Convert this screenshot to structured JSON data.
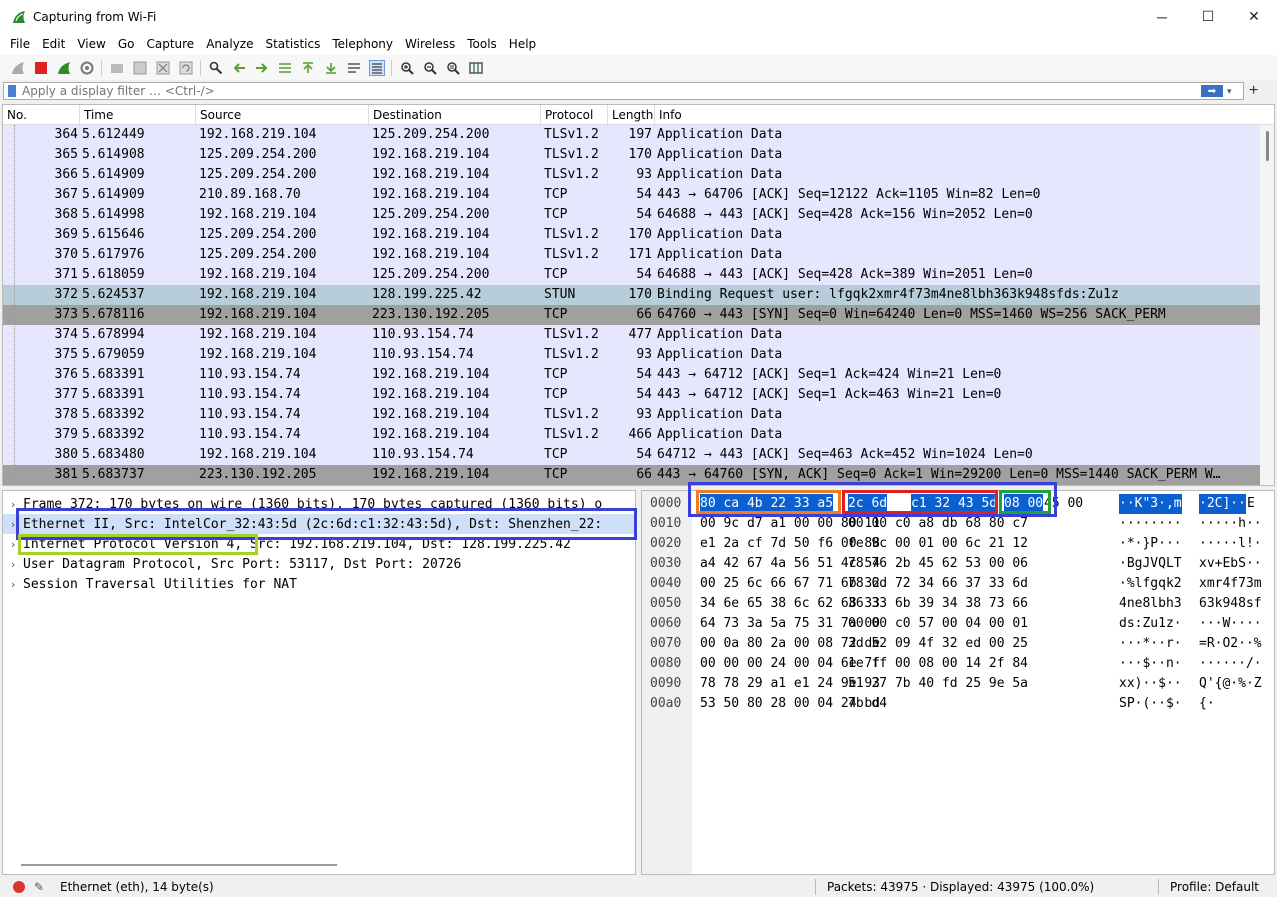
{
  "window": {
    "title": "Capturing from Wi-Fi",
    "minimize": "─",
    "maximize": "☐",
    "close": "✕"
  },
  "menu": [
    "File",
    "Edit",
    "View",
    "Go",
    "Capture",
    "Analyze",
    "Statistics",
    "Telephony",
    "Wireless",
    "Tools",
    "Help"
  ],
  "toolbar": {
    "icons": [
      "shark-fin-icon",
      "stop-capture-icon",
      "restart-capture-icon",
      "capture-options-icon",
      "open-file-icon",
      "save-file-icon",
      "close-file-icon",
      "reload-file-icon",
      "find-packet-icon",
      "go-back-icon",
      "go-forward-icon",
      "go-to-packet-icon",
      "go-first-icon",
      "go-last-icon",
      "auto-scroll-icon",
      "colorize-icon",
      "zoom-in-icon",
      "zoom-out-icon",
      "zoom-normal-icon",
      "resize-columns-icon"
    ]
  },
  "filter": {
    "placeholder": "Apply a display filter … <Ctrl-/>",
    "apply_label": "➡",
    "dropdown": "▾",
    "plus": "+"
  },
  "packet_list": {
    "columns": [
      "No.",
      "Time",
      "Source",
      "Destination",
      "Protocol",
      "Length",
      "Info"
    ],
    "rows": [
      {
        "no": "364",
        "time": "5.612449",
        "src": "192.168.219.104",
        "dst": "125.209.254.200",
        "proto": "TLSv1.2",
        "len": "197",
        "info": "Application Data",
        "style": "tls"
      },
      {
        "no": "365",
        "time": "5.614908",
        "src": "125.209.254.200",
        "dst": "192.168.219.104",
        "proto": "TLSv1.2",
        "len": "170",
        "info": "Application Data",
        "style": "tls"
      },
      {
        "no": "366",
        "time": "5.614909",
        "src": "125.209.254.200",
        "dst": "192.168.219.104",
        "proto": "TLSv1.2",
        "len": "93",
        "info": "Application Data",
        "style": "tls"
      },
      {
        "no": "367",
        "time": "5.614909",
        "src": "210.89.168.70",
        "dst": "192.168.219.104",
        "proto": "TCP",
        "len": "54",
        "info": "443 → 64706 [ACK] Seq=12122 Ack=1105 Win=82 Len=0",
        "style": "tcp"
      },
      {
        "no": "368",
        "time": "5.614998",
        "src": "192.168.219.104",
        "dst": "125.209.254.200",
        "proto": "TCP",
        "len": "54",
        "info": "64688 → 443 [ACK] Seq=428 Ack=156 Win=2052 Len=0",
        "style": "tcp"
      },
      {
        "no": "369",
        "time": "5.615646",
        "src": "125.209.254.200",
        "dst": "192.168.219.104",
        "proto": "TLSv1.2",
        "len": "170",
        "info": "Application Data",
        "style": "tls"
      },
      {
        "no": "370",
        "time": "5.617976",
        "src": "125.209.254.200",
        "dst": "192.168.219.104",
        "proto": "TLSv1.2",
        "len": "171",
        "info": "Application Data",
        "style": "tls"
      },
      {
        "no": "371",
        "time": "5.618059",
        "src": "192.168.219.104",
        "dst": "125.209.254.200",
        "proto": "TCP",
        "len": "54",
        "info": "64688 → 443 [ACK] Seq=428 Ack=389 Win=2051 Len=0",
        "style": "tcp"
      },
      {
        "no": "372",
        "time": "5.624537",
        "src": "192.168.219.104",
        "dst": "128.199.225.42",
        "proto": "STUN",
        "len": "170",
        "info": "Binding Request user: lfgqk2xmr4f73m4ne8lbh363k948sfds:Zu1z",
        "style": "stun"
      },
      {
        "no": "373",
        "time": "5.678116",
        "src": "192.168.219.104",
        "dst": "223.130.192.205",
        "proto": "TCP",
        "len": "66",
        "info": "64760 → 443 [SYN] Seq=0 Win=64240 Len=0 MSS=1460 WS=256 SACK_PERM",
        "style": "syn"
      },
      {
        "no": "374",
        "time": "5.678994",
        "src": "192.168.219.104",
        "dst": "110.93.154.74",
        "proto": "TLSv1.2",
        "len": "477",
        "info": "Application Data",
        "style": "tls"
      },
      {
        "no": "375",
        "time": "5.679059",
        "src": "192.168.219.104",
        "dst": "110.93.154.74",
        "proto": "TLSv1.2",
        "len": "93",
        "info": "Application Data",
        "style": "tls"
      },
      {
        "no": "376",
        "time": "5.683391",
        "src": "110.93.154.74",
        "dst": "192.168.219.104",
        "proto": "TCP",
        "len": "54",
        "info": "443 → 64712 [ACK] Seq=1 Ack=424 Win=21 Len=0",
        "style": "tcp"
      },
      {
        "no": "377",
        "time": "5.683391",
        "src": "110.93.154.74",
        "dst": "192.168.219.104",
        "proto": "TCP",
        "len": "54",
        "info": "443 → 64712 [ACK] Seq=1 Ack=463 Win=21 Len=0",
        "style": "tcp"
      },
      {
        "no": "378",
        "time": "5.683392",
        "src": "110.93.154.74",
        "dst": "192.168.219.104",
        "proto": "TLSv1.2",
        "len": "93",
        "info": "Application Data",
        "style": "tls"
      },
      {
        "no": "379",
        "time": "5.683392",
        "src": "110.93.154.74",
        "dst": "192.168.219.104",
        "proto": "TLSv1.2",
        "len": "466",
        "info": "Application Data",
        "style": "tls"
      },
      {
        "no": "380",
        "time": "5.683480",
        "src": "192.168.219.104",
        "dst": "110.93.154.74",
        "proto": "TCP",
        "len": "54",
        "info": "64712 → 443 [ACK] Seq=463 Ack=452 Win=1024 Len=0",
        "style": "tcp"
      },
      {
        "no": "381",
        "time": "5.683737",
        "src": "223.130.192.205",
        "dst": "192.168.219.104",
        "proto": "TCP",
        "len": "66",
        "info": "443 → 64760 [SYN, ACK] Seq=0 Ack=1 Win=29200 Len=0 MSS=1440 SACK_PERM W…",
        "style": "syn"
      }
    ]
  },
  "details": {
    "rows": [
      {
        "text": "Frame 372: 170 bytes on wire (1360 bits), 170 bytes captured (1360 bits) o",
        "selected": false
      },
      {
        "text": "Ethernet II, Src: IntelCor_32:43:5d (2c:6d:c1:32:43:5d), Dst: Shenzhen_22:",
        "selected": true
      },
      {
        "text": "Internet Protocol Version 4, Src: 192.168.219.104, Dst: 128.199.225.42",
        "selected": false
      },
      {
        "text": "User Datagram Protocol, Src Port: 53117, Dst Port: 20726",
        "selected": false
      },
      {
        "text": "Session Traversal Utilities for NAT",
        "selected": false
      }
    ],
    "arrow": "›"
  },
  "bytes": {
    "rows": [
      {
        "off": "0000",
        "hex1": "80 ca 4b 22 33 a5",
        "hex1b": "2c 6d",
        "hex2": "c1 32 43 5d",
        "hex2b": "08 00",
        "hex2c": "45 00",
        "asc1": "··K\"3·,m",
        "asc2": "·2C]··",
        "asc2b": "E"
      },
      {
        "off": "0010",
        "hex1": "00 9c d7 a1 00 00 80 11",
        "hex2": "00 00 c0 a8 db 68 80 c7",
        "asc1": "········",
        "asc2": "·····h··"
      },
      {
        "off": "0020",
        "hex1": "e1 2a cf 7d 50 f6 00 88",
        "hex2": "fe 9c 00 01 00 6c 21 12",
        "asc1": "·*·}P···",
        "asc2": "·····l!·"
      },
      {
        "off": "0030",
        "hex1": "a4 42 67 4a 56 51 4c 54",
        "hex2": "78 76 2b 45 62 53 00 06",
        "asc1": "·BgJVQLT",
        "asc2": "xv+EbS··"
      },
      {
        "off": "0040",
        "hex1": "00 25 6c 66 67 71 6b 32",
        "hex2": "78 6d 72 34 66 37 33 6d",
        "asc1": "·%lfgqk2",
        "asc2": "xmr4f73m"
      },
      {
        "off": "0050",
        "hex1": "34 6e 65 38 6c 62 68 33",
        "hex2": "36 33 6b 39 34 38 73 66",
        "asc1": "4ne8lbh3",
        "asc2": "63k948sf"
      },
      {
        "off": "0060",
        "hex1": "64 73 3a 5a 75 31 7a 00",
        "hex2": "00 00 c0 57 00 04 00 01",
        "asc1": "ds:Zu1z·",
        "asc2": "···W····"
      },
      {
        "off": "0070",
        "hex1": "00 0a 80 2a 00 08 72 de",
        "hex2": "3d 52 09 4f 32 ed 00 25",
        "asc1": "···*··r·",
        "asc2": "=R·O2··%"
      },
      {
        "off": "0080",
        "hex1": "00 00 00 24 00 04 6e 7f",
        "hex2": "1e ff 00 08 00 14 2f 84",
        "asc1": "···$··n·",
        "asc2": "······/·"
      },
      {
        "off": "0090",
        "hex1": "78 78 29 a1 e1 24 9e 93",
        "hex2": "51 27 7b 40 fd 25 9e 5a",
        "asc1": "xx)··$··",
        "asc2": "Q'{@·%·Z"
      },
      {
        "off": "00a0",
        "hex1": "53 50 80 28 00 04 24 bd",
        "hex2": "7b d4",
        "asc1": "SP·(··$·",
        "asc2": "{·"
      }
    ]
  },
  "annotations": {
    "colors": {
      "blue": "#3a3fd6",
      "orange": "#f07c1a",
      "red": "#e02020",
      "green": "#1fa23a",
      "lime": "#a6d12a"
    }
  },
  "status": {
    "interface": "Ethernet (eth), 14 byte(s)",
    "packets": "Packets: 43975 · Displayed: 43975 (100.0%)",
    "profile": "Profile: Default"
  }
}
